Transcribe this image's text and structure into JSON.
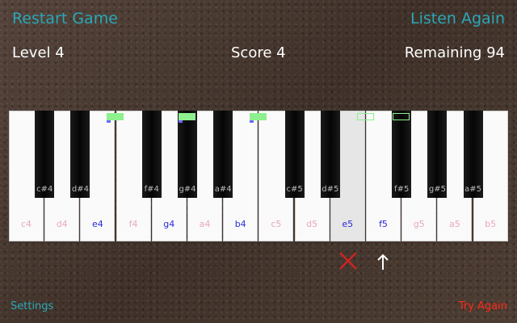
{
  "header": {
    "restart_label": "Restart Game",
    "listen_label": "Listen Again"
  },
  "stats": {
    "level_text": "Level 4",
    "score_text": "Score 4",
    "remaining_text": "Remaining 94"
  },
  "piano": {
    "white_keys": [
      {
        "label": "c4",
        "color": "#e8a8b8",
        "highlight": false
      },
      {
        "label": "d4",
        "color": "#e8a8b8",
        "highlight": false
      },
      {
        "label": "e4",
        "color": "#2a2ad8",
        "highlight": false
      },
      {
        "label": "f4",
        "color": "#e8a8b8",
        "highlight": false
      },
      {
        "label": "g4",
        "color": "#2a2ad8",
        "highlight": false
      },
      {
        "label": "a4",
        "color": "#e8a8b8",
        "highlight": false
      },
      {
        "label": "b4",
        "color": "#2a2ad8",
        "highlight": false
      },
      {
        "label": "c5",
        "color": "#e8a8b8",
        "highlight": false
      },
      {
        "label": "d5",
        "color": "#e8a8b8",
        "highlight": false
      },
      {
        "label": "e5",
        "color": "#2a2ad8",
        "highlight": true
      },
      {
        "label": "f5",
        "color": "#2a2ad8",
        "highlight": false
      },
      {
        "label": "g5",
        "color": "#e8a8b8",
        "highlight": false
      },
      {
        "label": "a5",
        "color": "#e8a8b8",
        "highlight": false
      },
      {
        "label": "b5",
        "color": "#e8a8b8",
        "highlight": false
      }
    ],
    "black_keys": [
      {
        "label": "c#4",
        "after": 0
      },
      {
        "label": "d#4",
        "after": 1
      },
      {
        "label": "f#4",
        "after": 3
      },
      {
        "label": "g#4",
        "after": 4
      },
      {
        "label": "a#4",
        "after": 5
      },
      {
        "label": "c#5",
        "after": 7
      },
      {
        "label": "d#5",
        "after": 8
      },
      {
        "label": "f#5",
        "after": 10
      },
      {
        "label": "g#5",
        "after": 11
      },
      {
        "label": "a#5",
        "after": 12
      }
    ],
    "markers": [
      {
        "white_index": 2,
        "style": "filled",
        "sub": true
      },
      {
        "white_index": 4,
        "style": "filled",
        "sub": true
      },
      {
        "white_index": 6,
        "style": "filled",
        "sub": true
      },
      {
        "white_index": 9,
        "style": "outline",
        "sub": false
      },
      {
        "white_index": 10,
        "style": "outline",
        "sub": false
      }
    ],
    "accent_color": "#8ef08e"
  },
  "feedback": {
    "wrong_icon": "x-mark-icon",
    "wrong_color": "#e02020",
    "arrow_icon": "up-arrow-icon",
    "arrow_color": "#ffffff"
  },
  "footer": {
    "settings_label": "Settings",
    "try_again_label": "Try Again"
  }
}
